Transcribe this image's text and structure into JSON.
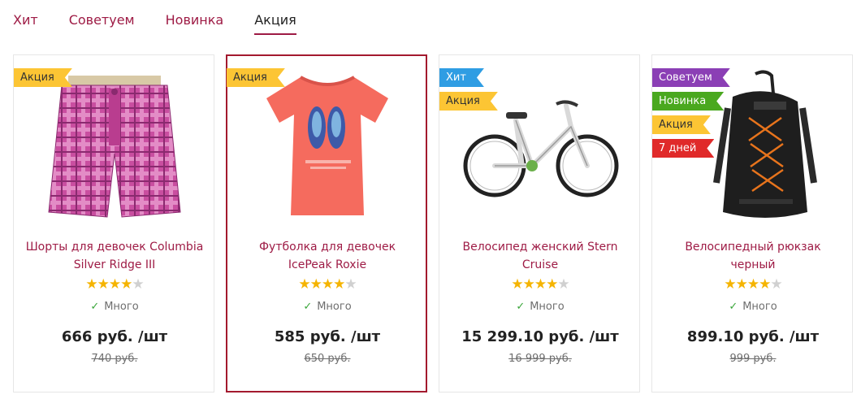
{
  "tabs": [
    {
      "label": "Хит",
      "active": false
    },
    {
      "label": "Советуем",
      "active": false
    },
    {
      "label": "Новинка",
      "active": false
    },
    {
      "label": "Акция",
      "active": true
    }
  ],
  "products": [
    {
      "name": "Шорты для девочек Columbia Silver Ridge III",
      "badges": [
        {
          "text": "Акция",
          "type": "sale"
        }
      ],
      "rating": 4,
      "stock": "Много",
      "price": "666 руб. /шт",
      "old_price": "740 руб.",
      "image": "plaid-shorts-image"
    },
    {
      "name": "Футболка для девочек IcePeak Roxie",
      "badges": [
        {
          "text": "Акция",
          "type": "sale"
        }
      ],
      "rating": 4,
      "stock": "Много",
      "price": "585 руб. /шт",
      "old_price": "650 руб.",
      "image": "coral-tshirt-image"
    },
    {
      "name": "Велосипед женский Stern Cruise",
      "badges": [
        {
          "text": "Хит",
          "type": "hit"
        },
        {
          "text": "Акция",
          "type": "sale"
        }
      ],
      "rating": 4,
      "stock": "Много",
      "price": "15 299.10 руб. /шт",
      "old_price": "16 999 руб.",
      "image": "bicycle-image"
    },
    {
      "name": "Велосипедный рюкзак черный",
      "badges": [
        {
          "text": "Советуем",
          "type": "rec"
        },
        {
          "text": "Новинка",
          "type": "new"
        },
        {
          "text": "Акция",
          "type": "sale"
        },
        {
          "text": "7 дней",
          "type": "days"
        }
      ],
      "rating": 4,
      "stock": "Много",
      "price": "899.10 руб. /шт",
      "old_price": "999 руб.",
      "image": "backpack-image"
    }
  ],
  "colors": {
    "accent": "#9e1b45",
    "sale": "#fcc534",
    "hit": "#2f9de3",
    "rec": "#8b3fb5",
    "new": "#4aa81f",
    "days": "#e02a2a",
    "hover_border": "#a31a2e"
  }
}
